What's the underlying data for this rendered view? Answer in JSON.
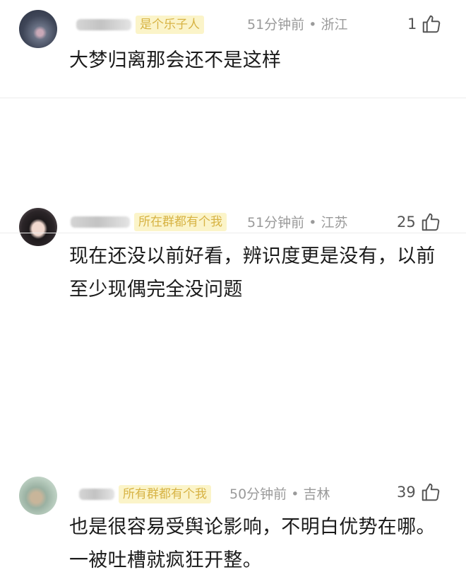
{
  "comments": [
    {
      "username_tag": "是个乐子人",
      "time": "51分钟前",
      "location": "浙江",
      "likes": "1",
      "text": "大梦归离那会还不是这样"
    },
    {
      "username_tag": "所在群都有个我",
      "time": "51分钟前",
      "location": "江苏",
      "likes": "25",
      "text": "现在还没以前好看，辨识度更是没有，以前至少现偶完全没问题"
    },
    {
      "username_tag": "所有群都有个我",
      "time": "50分钟前",
      "location": "吉林",
      "likes": "39",
      "text": "也是很容易受舆论影响，不明白优势在哪。一被吐槽就疯狂开整。"
    }
  ],
  "meta_separator": " • "
}
